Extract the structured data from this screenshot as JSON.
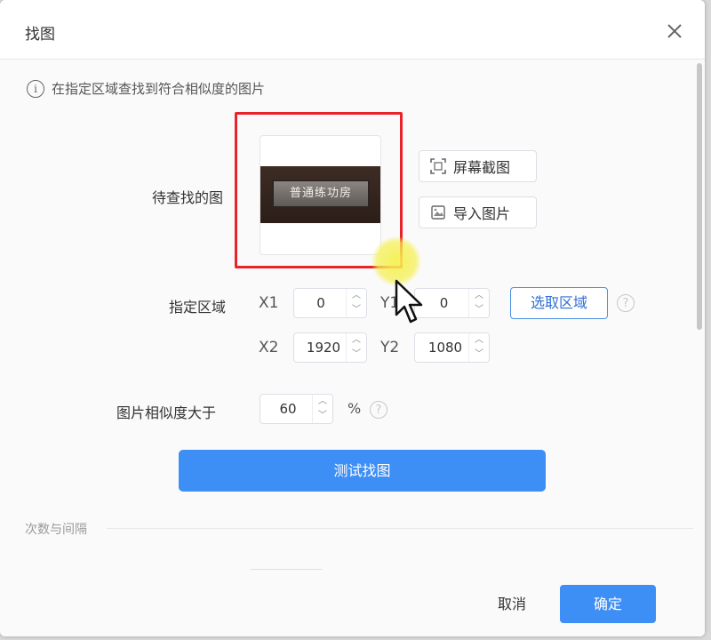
{
  "dialog": {
    "title": "找图",
    "hint": "在指定区域查找到符合相似度的图片"
  },
  "image_section": {
    "label": "待查找的图",
    "thumb_text": "普通练功房",
    "screenshot_button": "屏幕截图",
    "import_button": "导入图片"
  },
  "region": {
    "label": "指定区域",
    "x1_label": "X1",
    "y1_label": "Y1",
    "x2_label": "X2",
    "y2_label": "Y2",
    "x1_value": "0",
    "y1_value": "0",
    "x2_value": "1920",
    "y2_value": "1080",
    "select_button": "选取区域"
  },
  "similarity": {
    "label": "图片相似度大于",
    "value": "60",
    "unit": "%"
  },
  "test_button": "测试找图",
  "section": {
    "title": "次数与间隔"
  },
  "footer": {
    "cancel": "取消",
    "ok": "确定"
  },
  "colors": {
    "primary": "#3d8ef5",
    "highlight_frame": "#e8242a",
    "cursor_glow": "#f5f050"
  }
}
